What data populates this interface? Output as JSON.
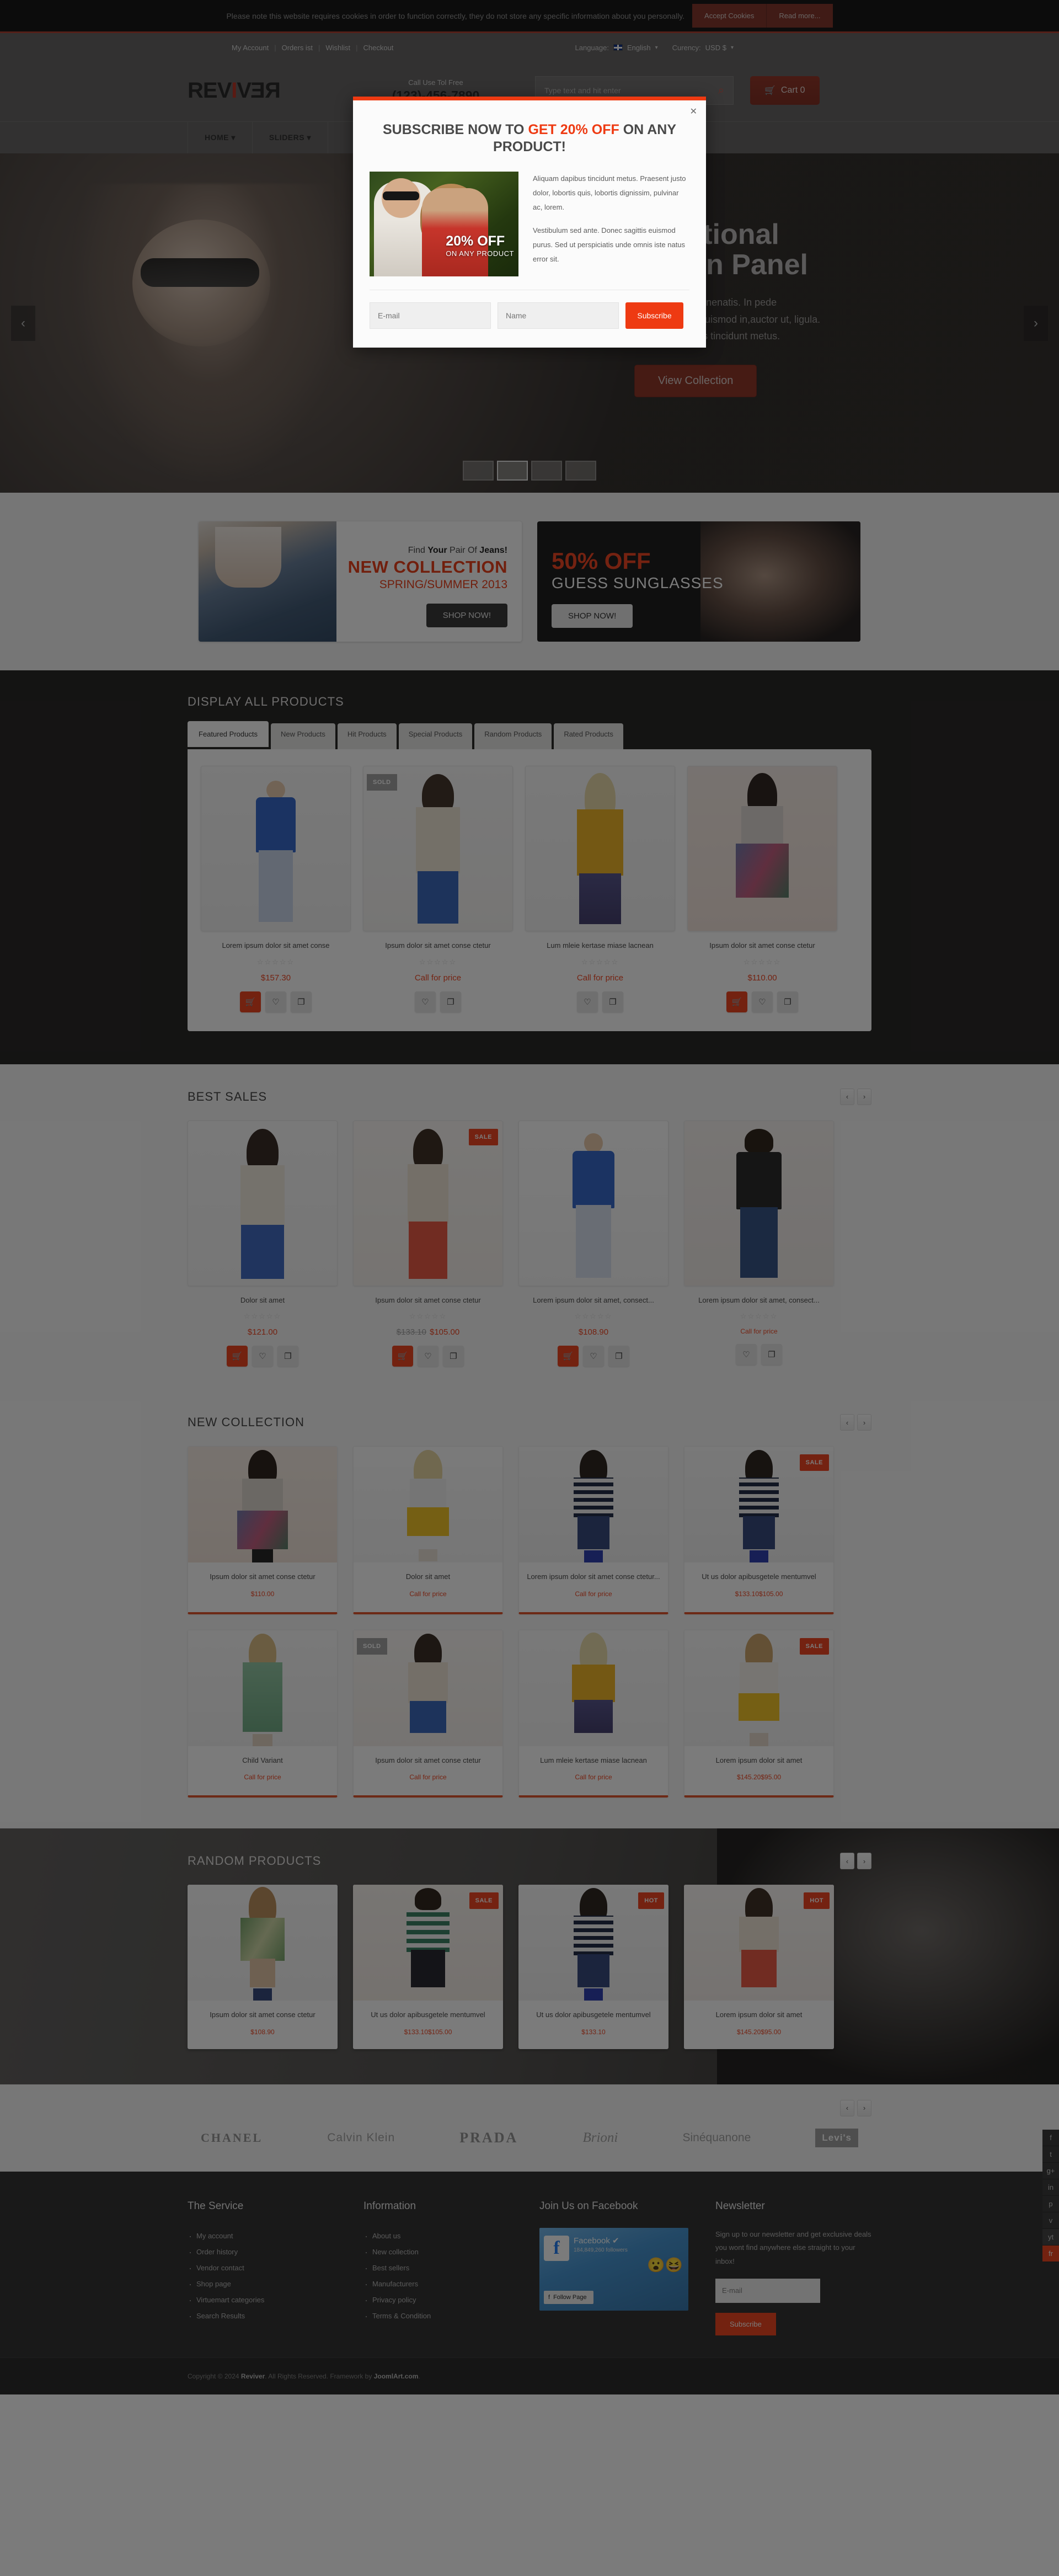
{
  "cookie": {
    "text": "Please note this website requires cookies in order to function correctly, they do not store any specific information about you personally.",
    "accept_label": "Accept Cookies",
    "readmore_label": "Read more..."
  },
  "topbar": {
    "links": [
      "My Account",
      "Orders ist",
      "Wishlist",
      "Checkout"
    ],
    "language_label": "Language:",
    "language_value": "English",
    "currency_label": "Curency:",
    "currency_value": "USD $"
  },
  "header": {
    "logo_part1": "REV",
    "logo_i": "I",
    "logo_part2": "V",
    "logo_part3": "E",
    "logo_part4": "R",
    "phone_label": "Call Use Tol Free",
    "phone_number": "(123)-456-7890",
    "search_placeholder": "Type text and hit enter",
    "search_value": "",
    "cart_label": "Cart 0"
  },
  "nav": {
    "items": [
      "HOME",
      "SLIDERS"
    ]
  },
  "hero": {
    "title": "Functional\nAdmin Panel",
    "title_line1": "Functional",
    "title_line2": "Admin Panel",
    "desc_line1": "Aliquet. Nulla venenatis. In pede",
    "desc_line2": "dolor sit amet, euismod in,auctor ut, ligula.",
    "desc_line3": "Aliquam dapibus tincidunt metus.",
    "cta_label": "View Collection",
    "prev_icon": "chevron-left",
    "next_icon": "chevron-right",
    "thumb_count": 4,
    "active_thumb": 1
  },
  "modal": {
    "title_pre": "SUBSCRIBE NOW TO ",
    "title_hl": "GET 20% OFF",
    "title_post": " ON ANY PRODUCT!",
    "image_off": "20% OFF",
    "image_sub": "ON ANY PRODUCT",
    "para1": "Aliquam dapibus tincidunt metus. Praesent justo dolor, lobortis quis, lobortis dignissim, pulvinar ac, lorem.",
    "para2": "Vestibulum sed ante. Donec sagittis euismod purus. Sed ut perspiciatis unde omnis iste natus error sit.",
    "email_placeholder": "E-mail",
    "name_placeholder": "Name",
    "subscribe_label": "Subscribe",
    "close_icon": "close-icon"
  },
  "promos": [
    {
      "small_pre": "Find ",
      "small_bold": "Your",
      "small_mid": " Pair Of ",
      "small_bold2": "Jeans!",
      "big": "NEW COLLECTION",
      "sub": "SPRING/SUMMER 2013",
      "button": "SHOP NOW!"
    },
    {
      "big": "50% OFF",
      "sub": "GUESS SUNGLASSES",
      "button": "SHOP NOW!"
    }
  ],
  "display_all": {
    "title": "DISPLAY ALL PRODUCTS",
    "tabs": [
      "Featured Products",
      "New Products",
      "Hit Products",
      "Special Products",
      "Random Products",
      "Rated Products"
    ],
    "active_tab": 0,
    "products": [
      {
        "name": "Lorem ipsum dolor sit amet conse",
        "price": "$157.30",
        "old_price": "",
        "badge": "",
        "rating": 0,
        "has_cart": true
      },
      {
        "name": "Ipsum dolor sit amet conse ctetur",
        "price": "Call for price",
        "old_price": "",
        "badge": "SOLD",
        "rating": 0,
        "has_cart": false
      },
      {
        "name": "Lum mleie kertase miase lacnean",
        "price": "Call for price",
        "old_price": "",
        "badge": "",
        "rating": 0,
        "has_cart": false
      },
      {
        "name": "Ipsum dolor sit amet conse ctetur",
        "price": "$110.00",
        "old_price": "",
        "badge": "",
        "rating": 0,
        "has_cart": true
      }
    ],
    "action_icons": [
      "cart-icon",
      "heart-icon",
      "compare-icon"
    ]
  },
  "best_sales": {
    "title": "BEST SALES",
    "products": [
      {
        "name": "Dolor sit amet",
        "price": "$121.00",
        "old_price": "",
        "badge": "",
        "has_cart": true
      },
      {
        "name": "Ipsum dolor sit amet conse ctetur",
        "price": "$105.00",
        "old_price": "$133.10",
        "badge": "SALE",
        "has_cart": true
      },
      {
        "name": "Lorem ipsum dolor sit amet, consect...",
        "price": "$108.90",
        "old_price": "",
        "badge": "",
        "has_cart": true
      },
      {
        "name": "Lorem ipsum dolor sit amet, consect...",
        "price": "Call for price",
        "old_price": "",
        "badge": "",
        "has_cart": false
      }
    ]
  },
  "new_collection": {
    "title": "NEW COLLECTION",
    "row1": [
      {
        "name": "Ipsum dolor sit amet conse ctetur",
        "price": "$110.00",
        "old_price": "",
        "badge": ""
      },
      {
        "name": "Dolor sit amet",
        "price": "Call for price",
        "old_price": "",
        "badge": ""
      },
      {
        "name": "Lorem ipsum dolor sit amet conse ctetur...",
        "price": "Call for price",
        "old_price": "",
        "badge": ""
      },
      {
        "name": "Ut us dolor apibusgetele mentumvel",
        "price": "$105.00",
        "old_price": "$133.10",
        "badge": "SALE"
      }
    ],
    "row2": [
      {
        "name": "Child Variant",
        "price": "Call for price",
        "old_price": "",
        "badge": ""
      },
      {
        "name": "Ipsum dolor sit amet conse ctetur",
        "price": "Call for price",
        "old_price": "",
        "badge": "SOLD"
      },
      {
        "name": "Lum mleie kertase miase lacnean",
        "price": "Call for price",
        "old_price": "",
        "badge": ""
      },
      {
        "name": "Lorem ipsum dolor sit amet",
        "price": "$95.00",
        "old_price": "$145.20",
        "badge": "SALE"
      }
    ]
  },
  "random_products": {
    "title": "RANDOM PRODUCTS",
    "products": [
      {
        "name": "Ipsum dolor sit amet conse ctetur",
        "price": "$108.90",
        "old_price": "",
        "badge": ""
      },
      {
        "name": "Ut us dolor apibusgetele mentumvel",
        "price": "$105.00",
        "old_price": "$133.10",
        "badge": "SALE"
      },
      {
        "name": "Ut us dolor apibusgetele mentumvel",
        "price": "$133.10",
        "old_price": "",
        "badge": "HOT"
      },
      {
        "name": "Lorem ipsum dolor sit amet",
        "price": "$95.00",
        "old_price": "$145.20",
        "badge": "HOT"
      }
    ]
  },
  "brands": [
    "CHANEL",
    "Calvin Klein",
    "PRADA",
    "Brioni",
    "Sinéquanone",
    "Levi's"
  ],
  "footer": {
    "col1_title": "The Service",
    "col1_items": [
      "My account",
      "Order history",
      "Vendor contact",
      "Shop page",
      "Virtuemart categories",
      "Search Results"
    ],
    "col2_title": "Information",
    "col2_items": [
      "About us",
      "New collection",
      "Best sellers",
      "Manufacturers",
      "Privacy policy",
      "Terms & Condition"
    ],
    "col3_title": "Join Us on Facebook",
    "fb_name": "Facebook",
    "fb_followers": "184,849,260 followers",
    "fb_follow_label": "Follow Page",
    "col4_title": "Newsletter",
    "news_text": "Sign up to our newsletter and get exclusive deals you wont find anywhere else straight to your inbox!",
    "news_placeholder": "E-mail",
    "news_button": "Subscribe"
  },
  "copyright": {
    "pre": "Copyright © 2024 ",
    "brand": "Reviver",
    "mid": ". All Rights Reserved. Framework by ",
    "framework": "JoomlArt.com",
    "post": "."
  },
  "social_rail": [
    "f",
    "t",
    "g+",
    "in",
    "p",
    "v",
    "yt",
    "fr"
  ],
  "stars": "☆☆☆☆☆",
  "colors": {
    "accent": "#ee3a12",
    "dark": "#1c1b1a",
    "header": "#5d5c5c"
  }
}
